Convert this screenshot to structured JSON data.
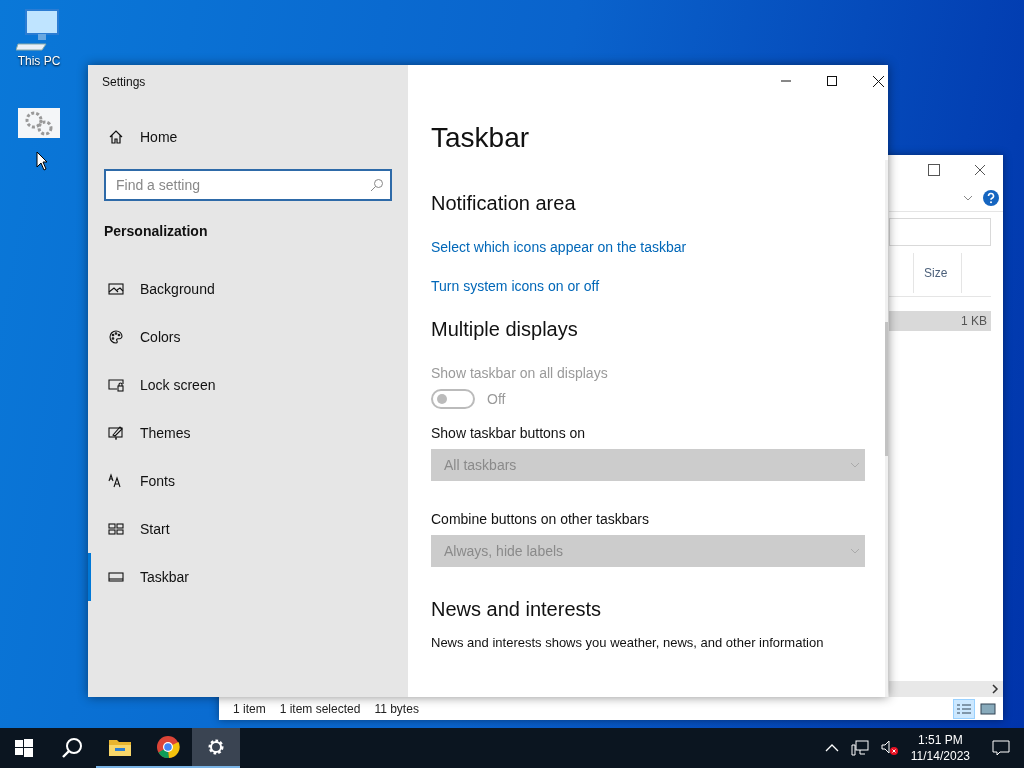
{
  "desktop": {
    "icons": [
      {
        "label": "This PC",
        "kind": "computer"
      },
      {
        "kind": "settings-shortcut"
      }
    ]
  },
  "explorer": {
    "column_header": "Size",
    "row_size": "1 KB",
    "row_selected": true,
    "status": [
      "1 item",
      "1 item selected",
      "11 bytes"
    ]
  },
  "settings": {
    "title": "Settings",
    "home": "Home",
    "search": {
      "placeholder": "Find a setting"
    },
    "section": "Personalization",
    "nav": [
      {
        "label": "Background",
        "selected": false
      },
      {
        "label": "Colors",
        "selected": false
      },
      {
        "label": "Lock screen",
        "selected": false
      },
      {
        "label": "Themes",
        "selected": false
      },
      {
        "label": "Fonts",
        "selected": false
      },
      {
        "label": "Start",
        "selected": false
      },
      {
        "label": "Taskbar",
        "selected": true
      }
    ],
    "page_title": "Taskbar",
    "content": [
      {
        "kind": "heading",
        "text": "Notification area"
      },
      {
        "kind": "link",
        "text": "Select which icons appear on the taskbar"
      },
      {
        "kind": "link",
        "text": "Turn system icons on or off"
      },
      {
        "kind": "heading",
        "text": "Multiple displays"
      },
      {
        "kind": "label",
        "text": "Show taskbar on all displays",
        "disabled": true
      },
      {
        "kind": "toggle",
        "text": "Off",
        "on": false,
        "disabled": true
      },
      {
        "kind": "label",
        "text": "Show taskbar buttons on",
        "disabled": false
      },
      {
        "kind": "dropdown",
        "value": "All taskbars",
        "disabled": true
      },
      {
        "kind": "label",
        "text": "Combine buttons on other taskbars",
        "disabled": false
      },
      {
        "kind": "dropdown",
        "value": "Always, hide labels",
        "disabled": true
      },
      {
        "kind": "heading",
        "text": "News and interests"
      },
      {
        "kind": "text",
        "text": "News and interests shows you weather, news, and other information"
      }
    ]
  },
  "taskbar": {
    "apps": [
      {
        "kind": "start",
        "selected": false
      },
      {
        "kind": "search",
        "selected": false
      },
      {
        "kind": "explorer",
        "selected": false,
        "running": true
      },
      {
        "kind": "chrome",
        "selected": false,
        "running": true
      },
      {
        "kind": "settings",
        "selected": true,
        "running": true
      }
    ],
    "time": "1:51 PM",
    "date": "11/14/2023"
  }
}
